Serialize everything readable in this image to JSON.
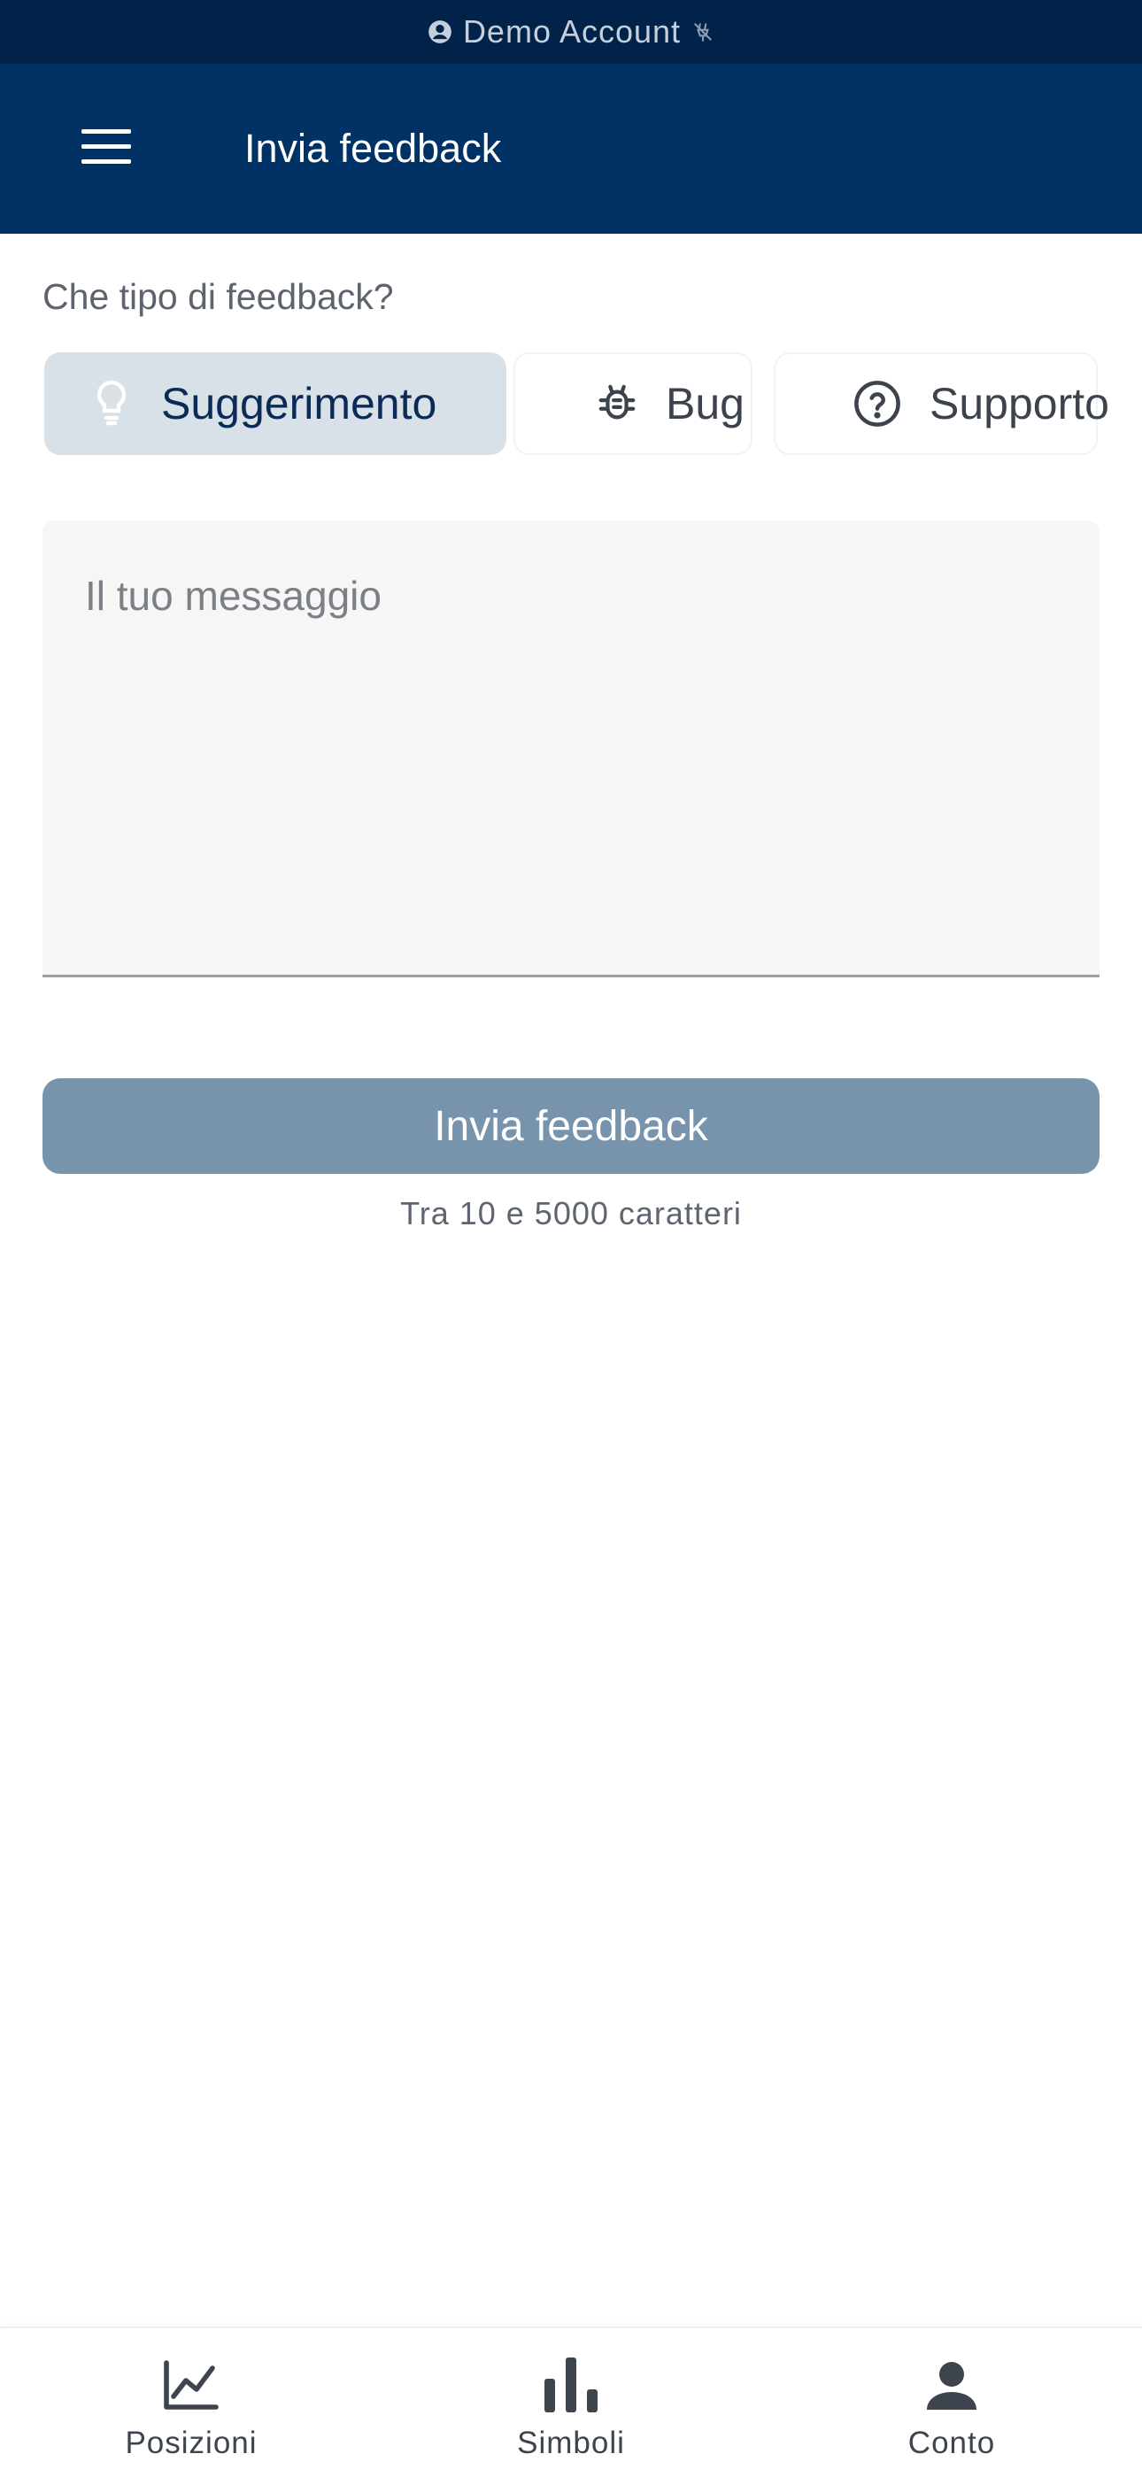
{
  "status_bar": {
    "account_label": "Demo Account",
    "account_icon": "account-circle-icon",
    "connection_icon": "connection-off-icon"
  },
  "app_bar": {
    "menu_icon": "hamburger-menu-icon",
    "title": "Invia feedback"
  },
  "form": {
    "question": "Che tipo di feedback?",
    "types": [
      {
        "label": "Suggerimento",
        "icon": "lightbulb-icon",
        "selected": true
      },
      {
        "label": "Bug",
        "icon": "bug-icon",
        "selected": false
      },
      {
        "label": "Supporto",
        "icon": "help-circle-icon",
        "selected": false
      }
    ],
    "message_placeholder": "Il tuo messaggio",
    "message_value": "",
    "submit_label": "Invia feedback",
    "hint": "Tra 10 e 5000 caratteri"
  },
  "bottom_nav": {
    "items": [
      {
        "label": "Posizioni",
        "icon": "line-chart-icon"
      },
      {
        "label": "Simboli",
        "icon": "bar-chart-icon"
      },
      {
        "label": "Conto",
        "icon": "person-icon"
      }
    ]
  },
  "colors": {
    "status_strip": "#012349",
    "app_bar": "#013266",
    "selected_segment": "#d8e0e8",
    "submit_button_disabled": "#7894ad"
  }
}
